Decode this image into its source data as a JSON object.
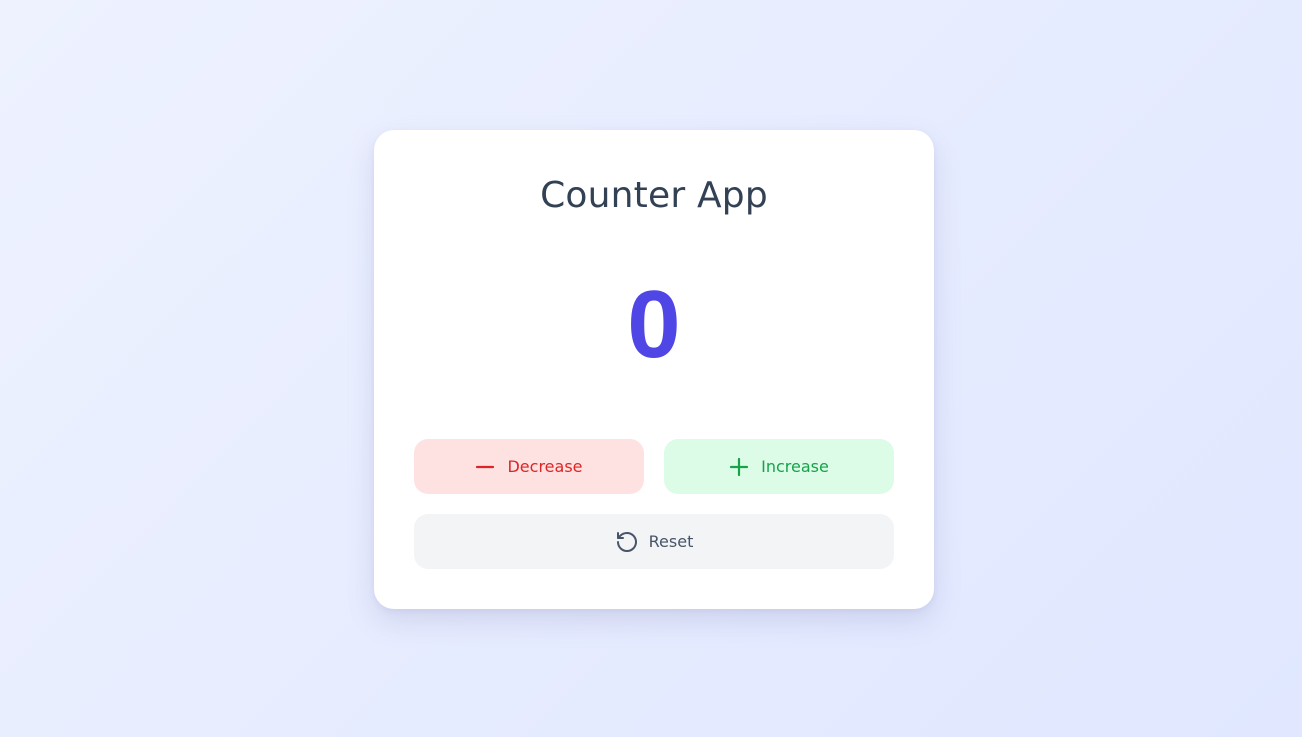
{
  "app": {
    "title": "Counter App",
    "count": "0"
  },
  "buttons": {
    "decrease": {
      "label": "Decrease",
      "icon": "minus-icon",
      "color": "#dc2626",
      "background": "#fee2e2"
    },
    "increase": {
      "label": "Increase",
      "icon": "plus-icon",
      "color": "#16a34a",
      "background": "#dcfce7"
    },
    "reset": {
      "label": "Reset",
      "icon": "reset-icon",
      "color": "#475569",
      "background": "#f3f4f6"
    }
  },
  "colors": {
    "accent": "#4f46e5",
    "title": "#334155"
  }
}
